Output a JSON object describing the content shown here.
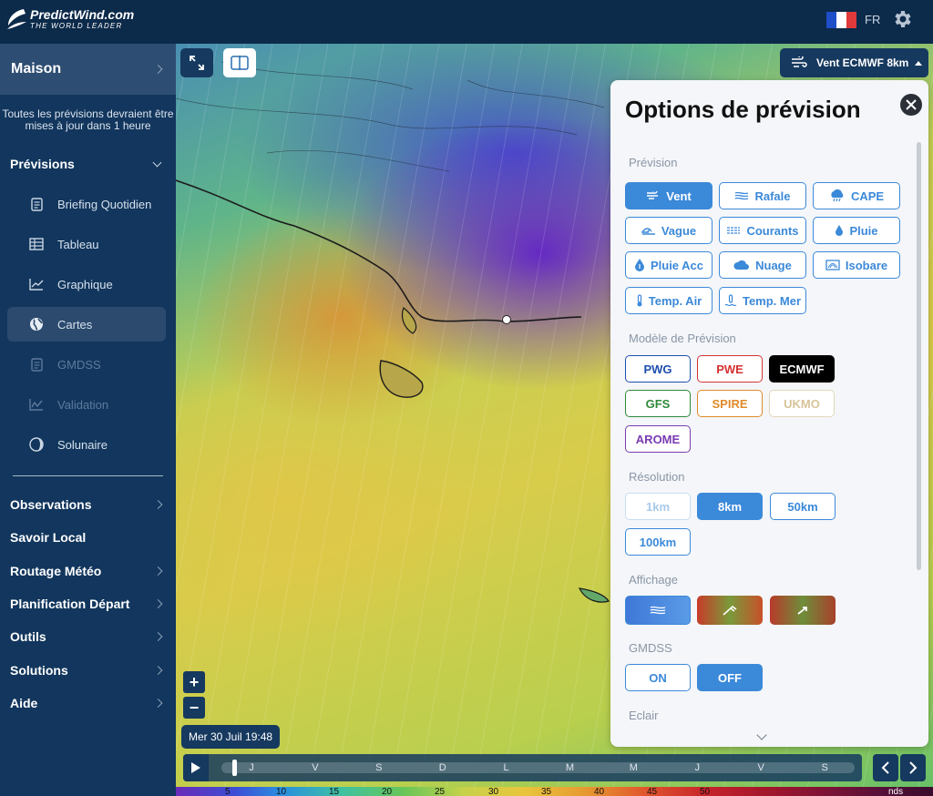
{
  "brand": {
    "title": "PredictWind.com",
    "subtitle": "THE WORLD LEADER"
  },
  "header": {
    "language": "FR",
    "flag_colors": [
      "#1f4ec9",
      "#ffffff",
      "#e03a3a"
    ]
  },
  "sidebar": {
    "home": "Maison",
    "update_note": "Toutes les prévisions devraient être mises à jour dans 1 heure",
    "forecasts": {
      "label": "Prévisions",
      "items": [
        {
          "label": "Briefing Quotidien",
          "icon": "document-icon",
          "state": "normal"
        },
        {
          "label": "Tableau",
          "icon": "table-icon",
          "state": "normal"
        },
        {
          "label": "Graphique",
          "icon": "line-chart-icon",
          "state": "normal"
        },
        {
          "label": "Cartes",
          "icon": "globe-icon",
          "state": "active"
        },
        {
          "label": "GMDSS",
          "icon": "document-icon",
          "state": "disabled"
        },
        {
          "label": "Validation",
          "icon": "chart-check-icon",
          "state": "disabled"
        },
        {
          "label": "Solunaire",
          "icon": "moon-icon",
          "state": "normal"
        }
      ]
    },
    "sections": [
      {
        "label": "Observations",
        "chevron": true
      },
      {
        "label": "Savoir Local",
        "chevron": false
      },
      {
        "label": "Routage Météo",
        "chevron": true
      },
      {
        "label": "Planification Départ",
        "chevron": true
      },
      {
        "label": "Outils",
        "chevron": true
      },
      {
        "label": "Solutions",
        "chevron": true
      },
      {
        "label": "Aide",
        "chevron": true
      }
    ]
  },
  "map": {
    "layer_button": "Vent ECMWF 8km",
    "zoom_in": "+",
    "zoom_out": "−",
    "current_time": "Mer 30 Juil 19:48",
    "timeline_days": [
      "J",
      "V",
      "S",
      "D",
      "L",
      "M",
      "M",
      "J",
      "V",
      "S"
    ],
    "scale_labels": [
      "5",
      "10",
      "15",
      "20",
      "25",
      "30",
      "35",
      "40",
      "45",
      "50",
      "nds"
    ]
  },
  "panel": {
    "title": "Options de prévision",
    "forecast_label": "Prévision",
    "forecast_options": [
      {
        "label": "Vent",
        "icon": "wind-icon",
        "selected": true
      },
      {
        "label": "Rafale",
        "icon": "gust-icon",
        "selected": false
      },
      {
        "label": "CAPE",
        "icon": "storm-cloud-icon",
        "selected": false
      },
      {
        "label": "Vague",
        "icon": "wave-icon",
        "selected": false
      },
      {
        "label": "Courants",
        "icon": "current-icon",
        "selected": false
      },
      {
        "label": "Pluie",
        "icon": "drop-icon",
        "selected": false
      },
      {
        "label": "Pluie Acc",
        "icon": "drops-icon",
        "selected": false
      },
      {
        "label": "Nuage",
        "icon": "cloud-icon",
        "selected": false
      },
      {
        "label": "Isobare",
        "icon": "isobar-icon",
        "selected": false
      },
      {
        "label": "Temp. Air",
        "icon": "thermometer-icon",
        "selected": false
      },
      {
        "label": "Temp. Mer",
        "icon": "sea-temp-icon",
        "selected": false
      }
    ],
    "model_label": "Modèle de Prévision",
    "models": [
      {
        "label": "PWG",
        "selected": false
      },
      {
        "label": "PWE",
        "selected": false
      },
      {
        "label": "ECMWF",
        "selected": true
      },
      {
        "label": "GFS",
        "selected": false
      },
      {
        "label": "SPIRE",
        "selected": false
      },
      {
        "label": "UKMO",
        "selected": false
      },
      {
        "label": "AROME",
        "selected": false
      }
    ],
    "resolution_label": "Résolution",
    "resolutions": [
      {
        "label": "1km",
        "selected": false,
        "disabled": true
      },
      {
        "label": "8km",
        "selected": true,
        "disabled": false
      },
      {
        "label": "50km",
        "selected": false,
        "disabled": false
      },
      {
        "label": "100km",
        "selected": false,
        "disabled": false
      }
    ],
    "display_label": "Affichage",
    "gmdss_label": "GMDSS",
    "gmdss_on": "ON",
    "gmdss_off": "OFF",
    "gmdss_value": "OFF",
    "lightning_label": "Eclair"
  }
}
